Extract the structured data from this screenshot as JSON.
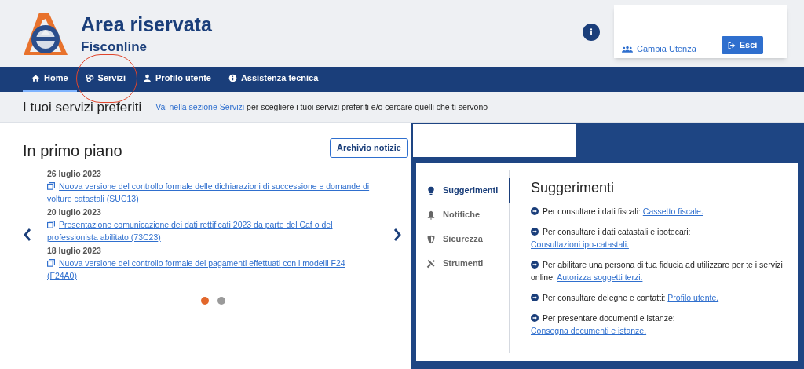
{
  "header": {
    "title": "Area riservata",
    "subtitle": "Fisconline",
    "user_box": {
      "change_user": "Cambia Utenza",
      "logout": "Esci"
    }
  },
  "nav": [
    {
      "label": "Home",
      "kind": "home",
      "selected": true
    },
    {
      "label": "Servizi",
      "kind": "services",
      "selected": false
    },
    {
      "label": "Profilo utente",
      "kind": "user",
      "selected": false
    },
    {
      "label": "Assistenza tecnica",
      "kind": "info",
      "selected": false
    }
  ],
  "favorites": {
    "title": "I tuoi servizi preferiti",
    "link": "Vai nella sezione Servizi",
    "text": "per scegliere i tuoi servizi preferiti e/o cercare quelli che ti servono"
  },
  "news": {
    "title": "In primo piano",
    "archive_button": "Archivio notizie",
    "items": [
      {
        "date": "26 luglio 2023",
        "title": "Nuova versione del controllo formale delle dichiarazioni di successione e domande di volture catastali (SUC13)"
      },
      {
        "date": "20 luglio 2023",
        "title": "Presentazione comunicazione dei dati rettificati 2023 da parte del Caf o del professionista abilitato (73C23)"
      },
      {
        "date": "18 luglio 2023",
        "title": " Nuova versione del controllo formale dei pagamenti effettuati con i modelli F24 (F24A0)"
      }
    ],
    "dots": [
      {
        "selected": true
      },
      {
        "selected": false
      }
    ]
  },
  "panel": {
    "tabs": [
      {
        "label": "Suggerimenti",
        "kind": "bulb",
        "selected": true
      },
      {
        "label": "Notifiche",
        "kind": "bell",
        "selected": false
      },
      {
        "label": "Sicurezza",
        "kind": "shield",
        "selected": false
      },
      {
        "label": "Strumenti",
        "kind": "tools",
        "selected": false
      }
    ],
    "title": "Suggerimenti",
    "suggestions": [
      {
        "text": "Per consultare i dati fiscali:",
        "link": "Cassetto fiscale."
      },
      {
        "text": "Per consultare i dati catastali e ipotecari:",
        "link": "Consultazioni ipo-catastali."
      },
      {
        "text": "Per abilitare una persona di tua fiducia ad utilizzare per te i servizi online:",
        "link": "Autorizza soggetti terzi."
      },
      {
        "text": "Per consultare deleghe e contatti:",
        "link": "Profilo utente."
      },
      {
        "text": "Per presentare documenti e istanze:",
        "link": "Consegna documenti e istanze."
      }
    ]
  }
}
